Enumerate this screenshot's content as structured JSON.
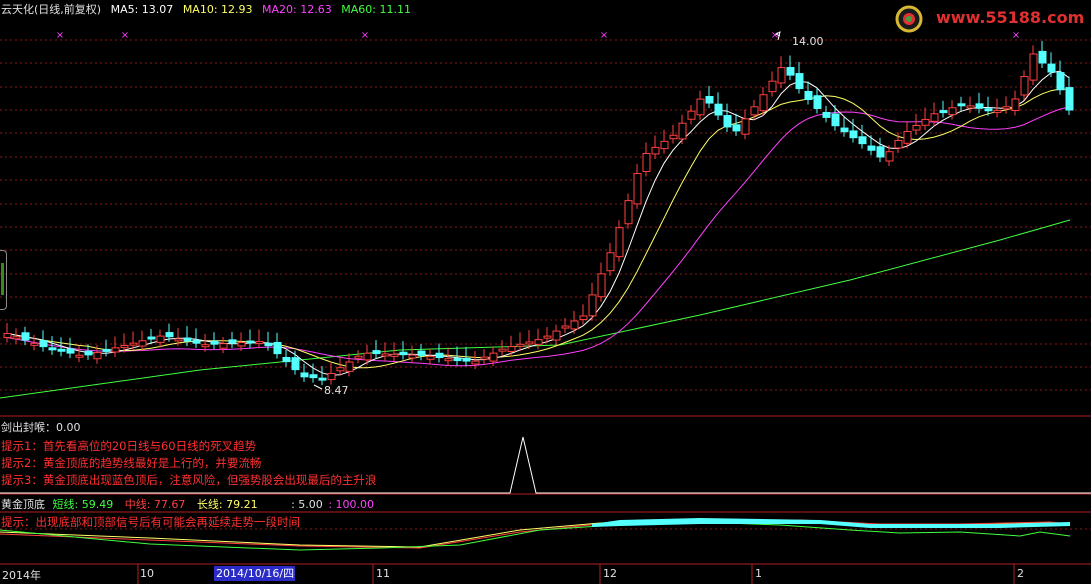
{
  "header": {
    "title": "云天化(日线,前复权)",
    "ma5": "MA5: 13.07",
    "ma10": "MA10: 12.93",
    "ma20": "MA20: 12.63",
    "ma60": "MA60: 11.11"
  },
  "logo": {
    "url_text": "www.55188.com"
  },
  "price_labels": {
    "high": "14.00",
    "low": "8.47"
  },
  "panel2": {
    "title": "剑出封喉：0.00",
    "tip1": "提示1：首先看高位的20日线与60日线的死叉趋势",
    "tip2": "提示2：黄金顶底的趋势线最好是上行的，并要流畅",
    "tip3": "提示3：黄金顶底出现蓝色顶后，注意风险，但强势股会出现最后的主升浪"
  },
  "panel3": {
    "name": "黄金顶底",
    "short": "短线: 59.49",
    "mid": "中线: 77.67",
    "long": "长线: 79.21",
    "v1": ": 5.00",
    "v2": ": 100.00",
    "tip": "提示：出现底部和顶部信号后有可能会再延续走势一段时间"
  },
  "date_axis": {
    "year": "2014年",
    "m10": "10",
    "selected_date": "2014/10/16/四",
    "m11": "11",
    "m12": "12",
    "m1": "1",
    "m2": "2"
  },
  "colors": {
    "up": "#ff4040",
    "down": "#54ffff",
    "ma5": "#ffffff",
    "ma10": "#ffff66",
    "ma20": "#ff40ff",
    "ma60": "#40ff40",
    "grid": "#8b1a1a",
    "tip": "#ff3030"
  }
}
